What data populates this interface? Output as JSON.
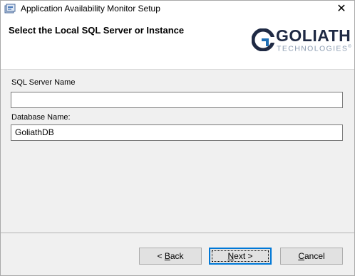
{
  "window": {
    "title": "Application Availability Monitor Setup",
    "close_glyph": "✕"
  },
  "banner": {
    "title": "Select the Local SQL Server or Instance",
    "logo": {
      "word": "GOLIATH",
      "sub": "TECHNOLOGIES",
      "mark": "G"
    }
  },
  "form": {
    "server_label": "SQL Server Name",
    "server_value": "",
    "db_label": "Database Name:",
    "db_value": "GoliathDB"
  },
  "buttons": {
    "back": {
      "accel": "B",
      "text_before": "< ",
      "text_after": "ack"
    },
    "next": {
      "accel": "N",
      "text_before": "",
      "text_after": "ext >"
    },
    "cancel": {
      "accel": "C",
      "text_before": "",
      "text_after": "ancel"
    }
  },
  "colors": {
    "logo_dark": "#1f2a44",
    "logo_blue": "#1f6fb5",
    "default_button_border": "#0078d7"
  }
}
